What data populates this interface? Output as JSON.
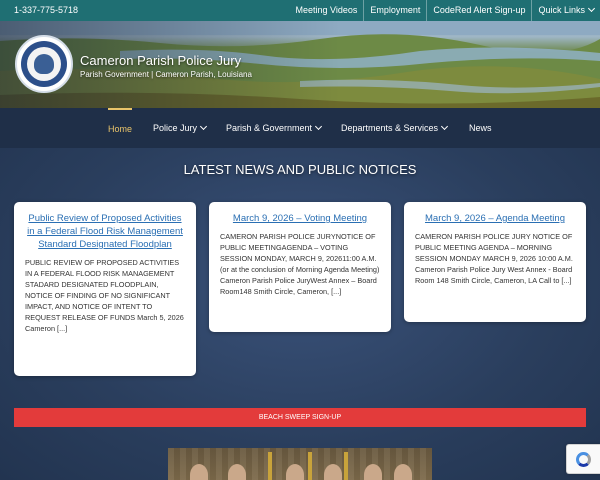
{
  "topbar": {
    "phone": "1-337-775-5718",
    "links": [
      "Meeting Videos",
      "Employment",
      "CodeRed Alert Sign-up",
      "Quick Links"
    ]
  },
  "header": {
    "title": "Cameron Parish Police Jury",
    "subtitle": "Parish Government | Cameron Parish, Louisiana"
  },
  "nav": {
    "items": [
      {
        "label": "Home",
        "active": true,
        "dropdown": false
      },
      {
        "label": "Police Jury",
        "active": false,
        "dropdown": true
      },
      {
        "label": "Parish & Government",
        "active": false,
        "dropdown": true
      },
      {
        "label": "Departments & Services",
        "active": false,
        "dropdown": true
      },
      {
        "label": "News",
        "active": false,
        "dropdown": false
      }
    ]
  },
  "main": {
    "section_title": "LATEST NEWS AND PUBLIC NOTICES",
    "cards": [
      {
        "title": "Public Review of Proposed Activities in a Federal Flood Risk Management Standard Designated Floodplan",
        "body": "PUBLIC REVIEW OF PROPOSED ACTIVITIES IN A FEDERAL FLOOD RISK MANAGEMENT STADARD DESIGNATED FLOODPLAIN, NOTICE OF FINDING OF NO SIGNIFICANT IMPACT, AND NOTICE OF INTENT TO REQUEST RELEASE OF FUNDS March 5, 2026 Cameron [...]"
      },
      {
        "title": "March 9, 2026 – Voting Meeting",
        "body": "CAMERON PARISH POLICE JURYNOTICE OF PUBLIC MEETINGAGENDA – VOTING SESSION MONDAY, MARCH 9, 202611:00 A.M. (or at the conclusion of Morning Agenda Meeting) Cameron Parish Police JuryWest Annex – Board Room148 Smith Circle, Cameron, [...]"
      },
      {
        "title": "March 9, 2026 – Agenda Meeting",
        "body": "CAMERON PARISH POLICE JURY NOTICE OF PUBLIC MEETING AGENDA – MORNING SESSION MONDAY MARCH 9, 2026 10:00 A.M. Cameron Parish Police Jury West Annex - Board Room 148 Smith Circle, Cameron, LA Call to [...]"
      }
    ],
    "banner": "BEACH SWEEP SIGN-UP"
  },
  "icons": {
    "seal": "parish-seal-icon",
    "dropdown": "chevron-down-icon",
    "recaptcha": "recaptcha-icon"
  },
  "colors": {
    "topbar": "#1f6f73",
    "nav": "#1f2f48",
    "active": "#e9c46a",
    "link": "#2a6fb3",
    "banner": "#e33b3b"
  }
}
